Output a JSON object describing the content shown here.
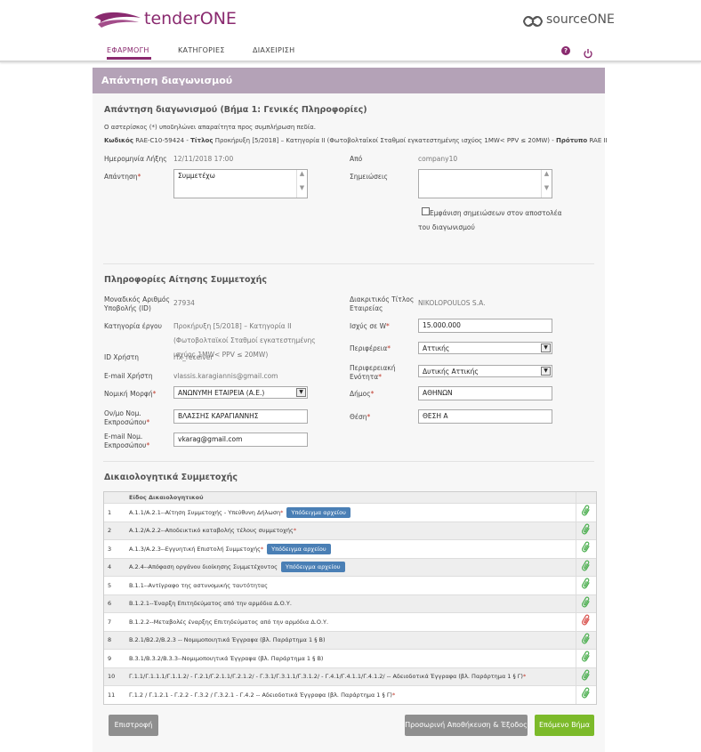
{
  "header": {
    "brand_name": "tenderONE",
    "partner_name": "sourceONE",
    "nav": [
      {
        "label": "ΕΦΑΡΜΟΓΗ",
        "active": true
      },
      {
        "label": "ΚΑΤΗΓΟΡΙΕΣ",
        "active": false
      },
      {
        "label": "ΔΙΑΧΕΙΡΙΣΗ",
        "active": false
      }
    ],
    "icons": [
      "help-icon",
      "power-icon"
    ]
  },
  "page": {
    "title": "Απάντηση διαγωνισμού",
    "step_title": "Απάντηση διαγωνισμού (Βήμα 1: Γενικές Πληροφορίες)",
    "required_note": "Ο αστερίσκος (*) υποδηλώνει απαραίτητα προς συμπλήρωση πεδία.",
    "code_label": "Κωδικός",
    "code_value": "RAE-C10-59424",
    "title_label": "Τίτλος",
    "title_value": "Προκήρυξη [5/2018] – Κατηγορία II (Φωτοβολταϊκοί Σταθμοί εγκατεστημένης ισχύος 1MW< PPV ≤ 20MW)",
    "template_label": "Πρότυπο",
    "template_value": "RAE II"
  },
  "general": {
    "expiry_label": "Ημερομηνία Λήξης",
    "expiry_value": "12/11/2018 17:00",
    "from_label": "Από",
    "from_value": "company10",
    "answer_label": "Απάντηση",
    "answer_value": "Συμμετέχω",
    "notes_label": "Σημειώσεις",
    "notes_value": "",
    "show_notes_label": "Εμφάνιση σημειώσεων στον αποστολέα του διαγωνισμού"
  },
  "participation": {
    "section_title": "Πληροφορίες Αίτησης Συμμετοχής",
    "id_label": "Μοναδικός Αριθμός Υποβολής (ID)",
    "id_value": "27934",
    "category_label": "Κατηγορία έργου",
    "category_value": "Προκήρυξη [5/2018] – Κατηγορία II (Φωτοβολταϊκοί Σταθμοί εγκατεστημένης ισχύος 1MW< PPV ≤ 20MW)",
    "user_id_label": "ID Χρήστη",
    "user_id_value": "rfx_receiver",
    "email_label": "E-mail Χρήστη",
    "email_value": "vlassis.karagiannis@gmail.com",
    "legal_form_label": "Νομική Μορφή",
    "legal_form_value": "ΑΝΩΝΥΜΗ ΕΤΑΙΡΕΙΑ (Α.Ε.)",
    "rep_name_label": "Ον/μο Νομ. Εκπροσώπου",
    "rep_name_value": "ΒΛΑΣΣΗΣ ΚΑΡΑΓΙΑΝΝΗΣ",
    "rep_email_label": "E-mail Νομ. Εκπροσώπου",
    "rep_email_value": "vkarag@gmail.com",
    "company_title_label": "Διακριτικός Τίτλος Εταιρείας",
    "company_title_value": "NIKOLOPOULOS S.A.",
    "power_label": "Ισχύς σε W",
    "power_value": "15.000.000",
    "region_label": "Περιφέρεια",
    "region_value": "Αττικής",
    "regional_unit_label": "Περιφερειακή Ενότητα",
    "regional_unit_value": "Δυτικής Αττικής",
    "municipality_label": "Δήμος",
    "municipality_value": "ΑΘΗΝΩΝ",
    "position_label": "Θέση",
    "position_value": "ΘΕΣΗ Α"
  },
  "documents": {
    "section_title": "Δικαιολογητικά Συμμετοχής",
    "column_header": "Είδος Δικαιολογητικού",
    "sample_button": "Υπόδειγμα αρχείου",
    "rows": [
      {
        "num": "1",
        "text": "Α.1.1/Α.2.1--Αίτηση Συμμετοχής - Υπεύθυνη Δήλωση",
        "required": true,
        "sample": true,
        "ok": true
      },
      {
        "num": "2",
        "text": "Α.1.2/Α.2.2--Αποδεικτικό καταβολής τέλους συμμετοχής",
        "required": true,
        "sample": false,
        "ok": true
      },
      {
        "num": "3",
        "text": "Α.1.3/Α.2.3--Εγγυητική Επιστολή Συμμετοχής",
        "required": true,
        "sample": true,
        "ok": true
      },
      {
        "num": "4",
        "text": "Α.2.4--Απόφαση οργάνου διοίκησης Συμμετέχοντος",
        "required": false,
        "sample": true,
        "ok": true
      },
      {
        "num": "5",
        "text": "Β.1.1--Αντίγραφο της αστυνομικής ταυτότητας",
        "required": false,
        "sample": false,
        "ok": true
      },
      {
        "num": "6",
        "text": "Β.1.2.1--Έναρξη Επιτηδεύματος από την αρμόδια Δ.Ο.Υ.",
        "required": false,
        "sample": false,
        "ok": true
      },
      {
        "num": "7",
        "text": "Β.1.2.2--Μεταβολές έναρξης Επιτηδεύματος από την αρμόδια Δ.Ο.Υ.",
        "required": false,
        "sample": false,
        "ok": false
      },
      {
        "num": "8",
        "text": "Β.2.1/Β2.2/Β.2.3 -- Νομιμοποιητικά Έγγραφα (βλ. Παράρτημα 1 § Β)",
        "required": false,
        "sample": false,
        "ok": true
      },
      {
        "num": "9",
        "text": "Β.3.1/Β.3.2/Β.3.3--Νομιμοποιητικά Έγγραφα (βλ. Παράρτημα 1 § Β)",
        "required": false,
        "sample": false,
        "ok": true
      },
      {
        "num": "10",
        "text": "Γ.1.1/Γ.1.1.1/Γ.1.1.2/ - Γ.2.1/Γ.2.1.1/Γ.2.1.2/ - Γ.3.1/Γ.3.1.1/Γ.3.1.2/ - Γ.4.1/Γ.4.1.1/Γ.4.1.2/ -- Αδειοδοτικά Έγγραφα (βλ. Παράρτημα 1 § Γ)",
        "required": true,
        "sample": false,
        "ok": true
      },
      {
        "num": "11",
        "text": "Γ.1.2 / Γ.1.2.1 - Γ.2.2 - Γ.3.2 / Γ.3.2.1 - Γ.4.2 -- Αδειοδοτικά Έγγραφα (βλ. Παράρτημα 1 § Γ)",
        "required": true,
        "sample": false,
        "ok": true
      }
    ]
  },
  "actions": {
    "back": "Επιστροφή",
    "save_exit": "Προσωρινή Αποθήκευση & Έξοδος",
    "next": "Επόμενο Βήμα"
  },
  "colors": {
    "brand": "#8a2a6f",
    "panel_header": "#b4a2b7",
    "sample_button": "#4a7fb5",
    "next_button": "#7cba2a",
    "grey_button": "#8f8f8f"
  }
}
